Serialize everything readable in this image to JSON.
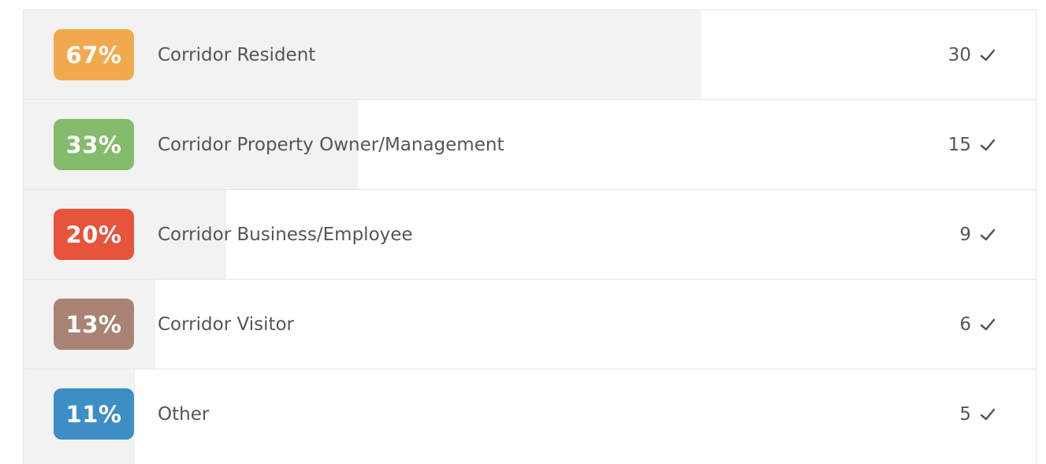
{
  "results": [
    {
      "percent": "67%",
      "fraction": 0.67,
      "label": "Corridor Resident",
      "count": "30",
      "color": "#f2a94d"
    },
    {
      "percent": "33%",
      "fraction": 0.33,
      "label": "Corridor Property Owner/Management",
      "count": "15",
      "color": "#84bb6d"
    },
    {
      "percent": "20%",
      "fraction": 0.2,
      "label": "Corridor Business/Employee",
      "count": "9",
      "color": "#e8533b"
    },
    {
      "percent": "13%",
      "fraction": 0.13,
      "label": "Corridor Visitor",
      "count": "6",
      "color": "#a98474"
    },
    {
      "percent": "11%",
      "fraction": 0.11,
      "label": "Other",
      "count": "5",
      "color": "#3d8ec5"
    }
  ],
  "icons": {
    "count": "check-icon"
  }
}
